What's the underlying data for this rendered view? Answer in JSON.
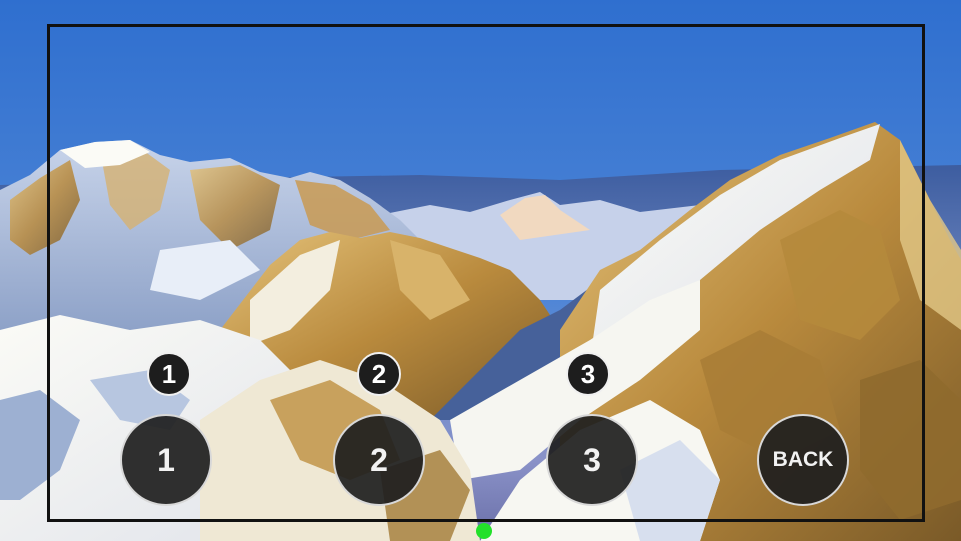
{
  "background": {
    "description_icon": "mountain-landscape-photo"
  },
  "badges": [
    {
      "label": "1"
    },
    {
      "label": "2"
    },
    {
      "label": "3"
    }
  ],
  "buttons": [
    {
      "label": "1"
    },
    {
      "label": "2"
    },
    {
      "label": "3"
    },
    {
      "label": "BACK"
    }
  ],
  "colors": {
    "button_fill": "#1e1e1e",
    "badge_fill": "#1d1d1d",
    "status_dot": "#22e02a",
    "frame": "#111111"
  }
}
